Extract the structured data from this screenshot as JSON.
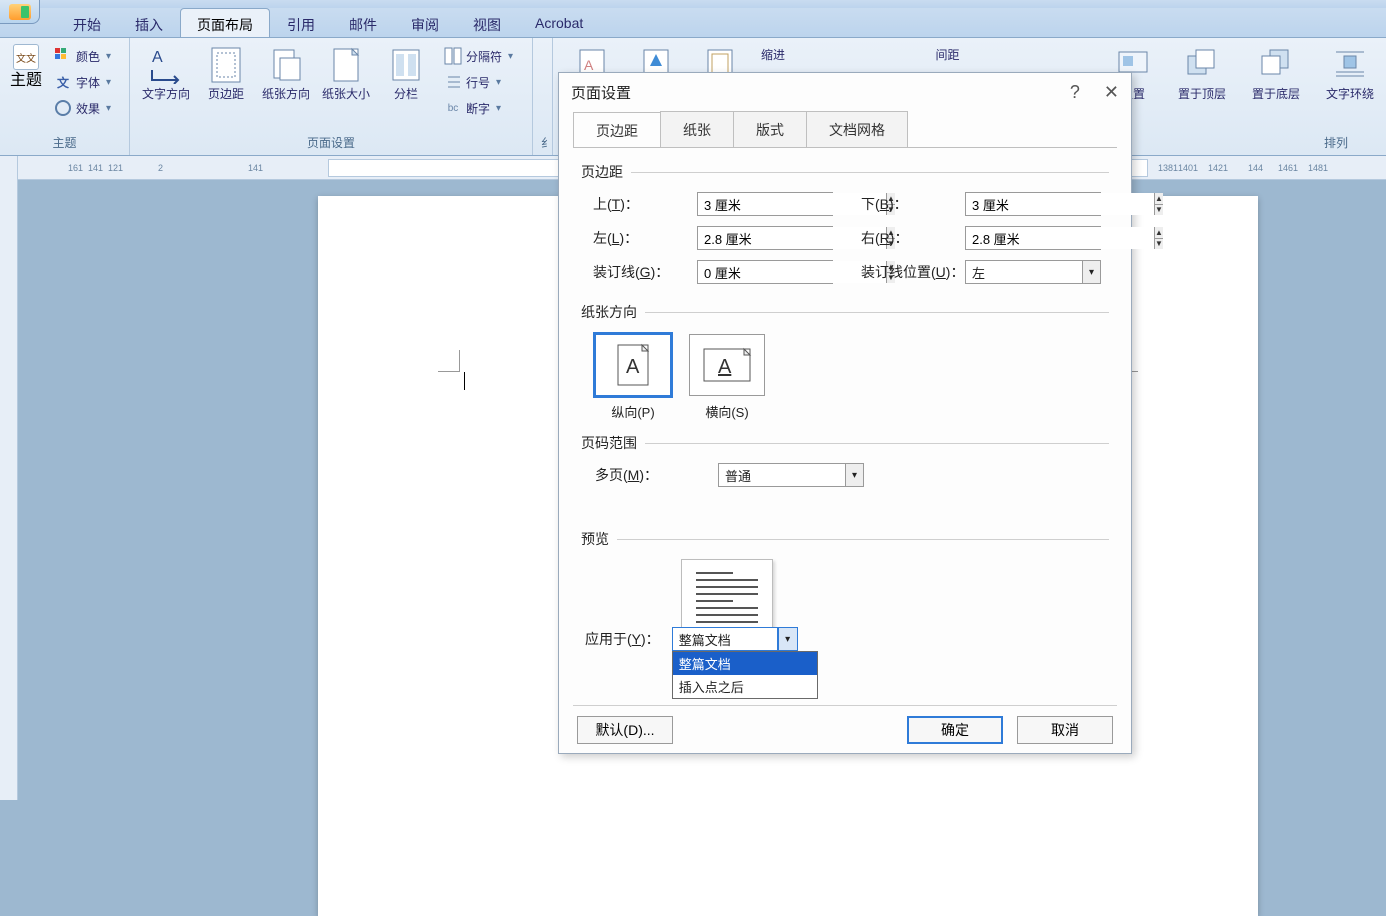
{
  "tabs": {
    "start": "开始",
    "insert": "插入",
    "page_layout": "页面布局",
    "references": "引用",
    "mailings": "邮件",
    "review": "审阅",
    "view": "视图",
    "acrobat": "Acrobat"
  },
  "ribbon": {
    "theme_group": "主题",
    "theme": "主题",
    "color": "颜色",
    "font": "字体",
    "effects": "效果",
    "page_setup_group": "页面设置",
    "text_direction": "文字方向",
    "margins": "页边距",
    "orientation": "纸张方向",
    "size": "纸张大小",
    "columns": "分栏",
    "breaks": "分隔符",
    "line_numbers": "行号",
    "hyphenation": "断字",
    "indent_group": "缩进",
    "spacing_group": "间距",
    "arrange_group": "排列",
    "position": "位置",
    "bring_front": "置于顶层",
    "send_back": "置于底层",
    "text_wrap": "文字环绕"
  },
  "ruler_numbers": [
    "161",
    "141",
    "121",
    "2",
    "141",
    "1381",
    "1401",
    "1421",
    "144",
    "1461",
    "1481"
  ],
  "dialog": {
    "title": "页面设置",
    "tabs": {
      "margins": "页边距",
      "paper": "纸张",
      "layout": "版式",
      "grid": "文档网格"
    },
    "section_margins": "页边距",
    "top_label": "上(T)：",
    "bottom_label": "下(B)：",
    "left_label": "左(L)：",
    "right_label": "右(R)：",
    "gutter_label": "装订线(G)：",
    "gutter_pos_label": "装订线位置(U)：",
    "top_val": "3 厘米",
    "bottom_val": "3 厘米",
    "left_val": "2.8 厘米",
    "right_val": "2.8 厘米",
    "gutter_val": "0 厘米",
    "gutter_pos_val": "左",
    "section_orientation": "纸张方向",
    "portrait": "纵向(P)",
    "landscape": "横向(S)",
    "section_pages": "页码范围",
    "multi_label": "多页(M)：",
    "multi_val": "普通",
    "section_preview": "预览",
    "apply_label": "应用于(Y)：",
    "apply_val": "整篇文档",
    "apply_opt1": "整篇文档",
    "apply_opt2": "插入点之后",
    "default_btn": "默认(D)...",
    "ok_btn": "确定",
    "cancel_btn": "取消"
  }
}
